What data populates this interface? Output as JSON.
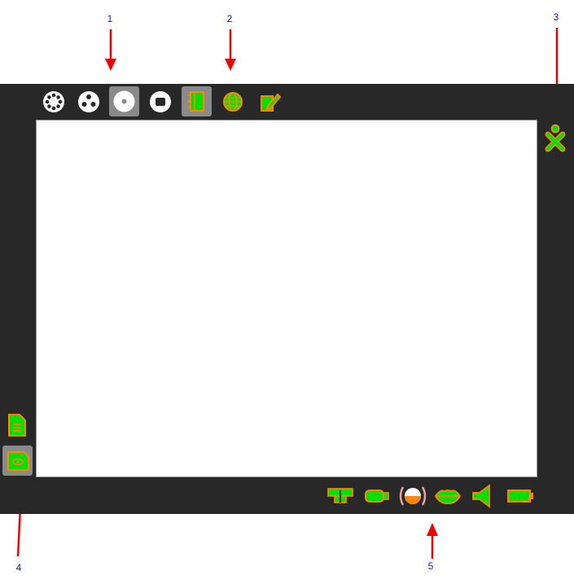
{
  "callouts": {
    "c1": "1",
    "c2": "2",
    "c3": "3",
    "c4": "4",
    "c5": "5"
  },
  "colors": {
    "frame": "#282828",
    "accent_fill": "#00e000",
    "accent_stroke": "#ff8800",
    "selected_bg": "#8a8a8a",
    "callout_arrow": "#ee0000",
    "callout_text": "#1a1aa6"
  },
  "toolbar": {
    "zoom_buttons": [
      "neighborhood-view",
      "group-view",
      "home-view",
      "activity-view"
    ],
    "activity_icons": [
      "journal-icon",
      "browse-icon",
      "write-icon"
    ],
    "selected_zoom": "home-view",
    "selected_activity": "journal-icon"
  },
  "sidebar": {
    "icons": [
      "document-icon",
      "picture-document-icon"
    ],
    "selected": "picture-document-icon"
  },
  "tray": {
    "icons": [
      "network-icon",
      "usb-drive-icon",
      "microphone-level-icon",
      "speech-icon",
      "speaker-icon",
      "battery-icon"
    ]
  },
  "user": {
    "icon": "xo-buddy-icon"
  }
}
